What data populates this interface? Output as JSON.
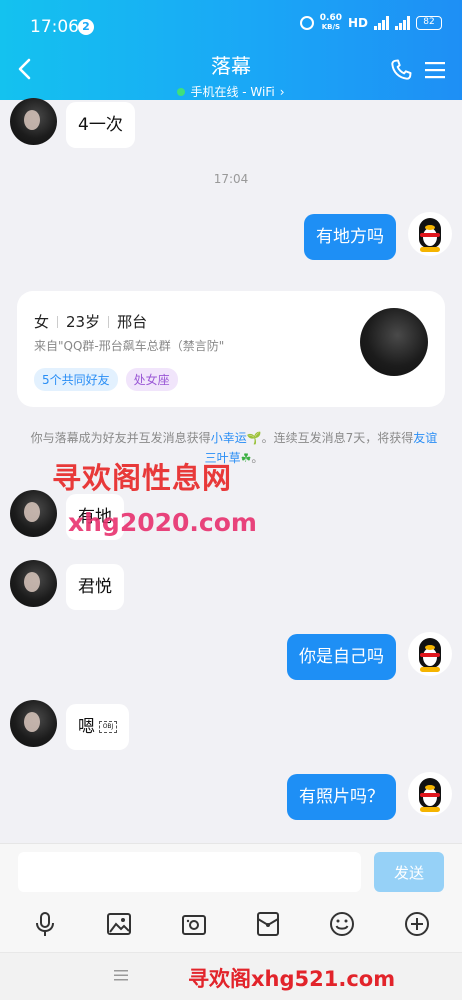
{
  "status_bar": {
    "time": "17:06",
    "notification_count": "2",
    "net_speed_value": "0.60",
    "net_speed_unit": "KB/S",
    "hd_label": "HD",
    "battery": "82"
  },
  "header": {
    "title": "落幕",
    "subtitle": "手机在线 - WiFi",
    "subtitle_arrow": "›"
  },
  "messages": [
    {
      "side": "in",
      "text": "4一次"
    },
    {
      "side": "out",
      "text": "有地方吗"
    },
    {
      "side": "in",
      "text": "有地"
    },
    {
      "side": "in",
      "text": "君悦"
    },
    {
      "side": "out",
      "text": "你是自己吗"
    },
    {
      "side": "in",
      "text": "嗯"
    },
    {
      "side": "out",
      "text": "有照片吗？"
    }
  ],
  "timestamp": "17:04",
  "profile_card": {
    "gender": "女",
    "age": "23岁",
    "city": "邢台",
    "source": "来自\"QQ群-邢台飙车总群（禁言防\"",
    "tags": [
      "5个共同好友",
      "处女座"
    ]
  },
  "friend_notice": {
    "part1": "你与落幕成为好友并互发消息获得",
    "link1": "小幸运",
    "part2": "。连续互发消息7天，将获得",
    "link2": "友谊三叶草",
    "part3": "。"
  },
  "watermarks": {
    "line1": "寻欢阁性息网",
    "line2": "xhg2020.com",
    "line3": "寻欢阁xhg521.com"
  },
  "input": {
    "placeholder": "",
    "send_label": "发送"
  },
  "toolbar_icons": [
    "microphone-icon",
    "image-icon",
    "camera-icon",
    "red-packet-icon",
    "emoji-icon",
    "plus-icon"
  ],
  "colors": {
    "header_start": "#14c2ef",
    "header_end": "#1e8ff5",
    "outgoing_bubble": "#1e8ff5",
    "send_button": "#96d1f7",
    "link": "#2a8ef5",
    "watermark": "#e82a2a"
  }
}
